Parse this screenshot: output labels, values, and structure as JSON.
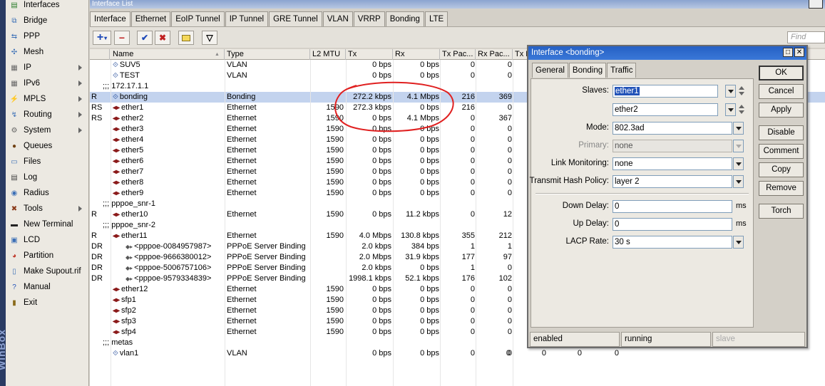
{
  "sidebar_brand": "WinBox",
  "menu": [
    {
      "label": "Interfaces",
      "icon": "interfaces-icon",
      "arrow": false
    },
    {
      "label": "Bridge",
      "icon": "bridge-icon",
      "arrow": false
    },
    {
      "label": "PPP",
      "icon": "ppp-icon",
      "arrow": false
    },
    {
      "label": "Mesh",
      "icon": "mesh-icon",
      "arrow": false
    },
    {
      "label": "IP",
      "icon": "ip-icon",
      "arrow": true
    },
    {
      "label": "IPv6",
      "icon": "ipv6-icon",
      "arrow": true
    },
    {
      "label": "MPLS",
      "icon": "mpls-icon",
      "arrow": true
    },
    {
      "label": "Routing",
      "icon": "routing-icon",
      "arrow": true
    },
    {
      "label": "System",
      "icon": "system-icon",
      "arrow": true
    },
    {
      "label": "Queues",
      "icon": "queues-icon",
      "arrow": false
    },
    {
      "label": "Files",
      "icon": "files-icon",
      "arrow": false
    },
    {
      "label": "Log",
      "icon": "log-icon",
      "arrow": false
    },
    {
      "label": "Radius",
      "icon": "radius-icon",
      "arrow": false
    },
    {
      "label": "Tools",
      "icon": "tools-icon",
      "arrow": true
    },
    {
      "label": "New Terminal",
      "icon": "terminal-icon",
      "arrow": false
    },
    {
      "label": "LCD",
      "icon": "lcd-icon",
      "arrow": false
    },
    {
      "label": "Partition",
      "icon": "partition-icon",
      "arrow": false
    },
    {
      "label": "Make Supout.rif",
      "icon": "supout-icon",
      "arrow": false
    },
    {
      "label": "Manual",
      "icon": "manual-icon",
      "arrow": false
    },
    {
      "label": "Exit",
      "icon": "exit-icon",
      "arrow": false
    }
  ],
  "window": {
    "title": "Interface List",
    "tabs": [
      "Interface",
      "Ethernet",
      "EoIP Tunnel",
      "IP Tunnel",
      "GRE Tunnel",
      "VLAN",
      "VRRP",
      "Bonding",
      "LTE"
    ],
    "find_placeholder": "Find"
  },
  "table": {
    "columns": [
      "Name",
      "Type",
      "L2 MTU",
      "Tx",
      "Rx",
      "Tx Pac...",
      "Rx Pac...",
      "Tx D"
    ],
    "rows": [
      {
        "flag": "",
        "name": "SUV5",
        "icon": "bond",
        "type": "VLAN",
        "mtu": "",
        "tx": "0 bps",
        "rx": "0 bps",
        "txp": "0",
        "rxp": "0",
        "indent": 0
      },
      {
        "flag": "",
        "name": "TEST",
        "icon": "bond",
        "type": "VLAN",
        "mtu": "",
        "tx": "0 bps",
        "rx": "0 bps",
        "txp": "0",
        "rxp": "0",
        "indent": 0
      },
      {
        "group": ";;; 172.17.1.1"
      },
      {
        "flag": "R",
        "name": "bonding",
        "icon": "bond",
        "type": "Bonding",
        "mtu": "",
        "tx": "272.2 kbps",
        "rx": "4.1 Mbps",
        "txp": "216",
        "rxp": "369",
        "indent": 0,
        "selected": true
      },
      {
        "flag": "RS",
        "name": "ether1",
        "icon": "eth",
        "type": "Ethernet",
        "mtu": "1590",
        "tx": "272.3 kbps",
        "rx": "0 bps",
        "txp": "216",
        "rxp": "0",
        "indent": 0
      },
      {
        "flag": "RS",
        "name": "ether2",
        "icon": "eth",
        "type": "Ethernet",
        "mtu": "1590",
        "tx": "0 bps",
        "rx": "4.1 Mbps",
        "txp": "0",
        "rxp": "367",
        "indent": 0
      },
      {
        "flag": "",
        "name": "ether3",
        "icon": "eth",
        "type": "Ethernet",
        "mtu": "1590",
        "tx": "0 bps",
        "rx": "0 bps",
        "txp": "0",
        "rxp": "0",
        "indent": 0
      },
      {
        "flag": "",
        "name": "ether4",
        "icon": "eth",
        "type": "Ethernet",
        "mtu": "1590",
        "tx": "0 bps",
        "rx": "0 bps",
        "txp": "0",
        "rxp": "0",
        "indent": 0
      },
      {
        "flag": "",
        "name": "ether5",
        "icon": "eth",
        "type": "Ethernet",
        "mtu": "1590",
        "tx": "0 bps",
        "rx": "0 bps",
        "txp": "0",
        "rxp": "0",
        "indent": 0
      },
      {
        "flag": "",
        "name": "ether6",
        "icon": "eth",
        "type": "Ethernet",
        "mtu": "1590",
        "tx": "0 bps",
        "rx": "0 bps",
        "txp": "0",
        "rxp": "0",
        "indent": 0
      },
      {
        "flag": "",
        "name": "ether7",
        "icon": "eth",
        "type": "Ethernet",
        "mtu": "1590",
        "tx": "0 bps",
        "rx": "0 bps",
        "txp": "0",
        "rxp": "0",
        "indent": 0
      },
      {
        "flag": "",
        "name": "ether8",
        "icon": "eth",
        "type": "Ethernet",
        "mtu": "1590",
        "tx": "0 bps",
        "rx": "0 bps",
        "txp": "0",
        "rxp": "0",
        "indent": 0
      },
      {
        "flag": "",
        "name": "ether9",
        "icon": "eth",
        "type": "Ethernet",
        "mtu": "1590",
        "tx": "0 bps",
        "rx": "0 bps",
        "txp": "0",
        "rxp": "0",
        "indent": 0
      },
      {
        "group": ";;; pppoe_snr-1"
      },
      {
        "flag": "R",
        "name": "ether10",
        "icon": "eth",
        "type": "Ethernet",
        "mtu": "1590",
        "tx": "0 bps",
        "rx": "11.2 kbps",
        "txp": "0",
        "rxp": "12",
        "indent": 0
      },
      {
        "group": ";;; pppoe_snr-2"
      },
      {
        "flag": "R",
        "name": "ether11",
        "icon": "eth",
        "type": "Ethernet",
        "mtu": "1590",
        "tx": "4.0 Mbps",
        "rx": "130.8 kbps",
        "txp": "355",
        "rxp": "212",
        "indent": 0
      },
      {
        "flag": "DR",
        "name": "<pppoe-0084957987>",
        "icon": "ppp",
        "type": "PPPoE Server Binding",
        "mtu": "",
        "tx": "2.0 kbps",
        "rx": "384 bps",
        "txp": "1",
        "rxp": "1",
        "indent": 1
      },
      {
        "flag": "DR",
        "name": "<pppoe-9666380012>",
        "icon": "ppp",
        "type": "PPPoE Server Binding",
        "mtu": "",
        "tx": "2.0 Mbps",
        "rx": "31.9 kbps",
        "txp": "177",
        "rxp": "97",
        "indent": 1
      },
      {
        "flag": "DR",
        "name": "<pppoe-5006757106>",
        "icon": "ppp",
        "type": "PPPoE Server Binding",
        "mtu": "",
        "tx": "2.0 kbps",
        "rx": "0 bps",
        "txp": "1",
        "rxp": "0",
        "indent": 1
      },
      {
        "flag": "DR",
        "name": "<pppoe-9579334839>",
        "icon": "ppp",
        "type": "PPPoE Server Binding",
        "mtu": "",
        "tx": "1998.1 kbps",
        "rx": "52.1 kbps",
        "txp": "176",
        "rxp": "102",
        "indent": 1
      },
      {
        "flag": "",
        "name": "ether12",
        "icon": "eth",
        "type": "Ethernet",
        "mtu": "1590",
        "tx": "0 bps",
        "rx": "0 bps",
        "txp": "0",
        "rxp": "0",
        "indent": 0
      },
      {
        "flag": "",
        "name": "sfp1",
        "icon": "eth",
        "type": "Ethernet",
        "mtu": "1590",
        "tx": "0 bps",
        "rx": "0 bps",
        "txp": "0",
        "rxp": "0",
        "indent": 0
      },
      {
        "flag": "",
        "name": "sfp2",
        "icon": "eth",
        "type": "Ethernet",
        "mtu": "1590",
        "tx": "0 bps",
        "rx": "0 bps",
        "txp": "0",
        "rxp": "0",
        "indent": 0
      },
      {
        "flag": "",
        "name": "sfp3",
        "icon": "eth",
        "type": "Ethernet",
        "mtu": "1590",
        "tx": "0 bps",
        "rx": "0 bps",
        "txp": "0",
        "rxp": "0",
        "indent": 0
      },
      {
        "flag": "",
        "name": "sfp4",
        "icon": "eth",
        "type": "Ethernet",
        "mtu": "1590",
        "tx": "0 bps",
        "rx": "0 bps",
        "txp": "0",
        "rxp": "0",
        "indent": 0
      },
      {
        "group": ";;; metas"
      },
      {
        "flag": "",
        "name": "vlan1",
        "icon": "bond",
        "type": "VLAN",
        "mtu": "",
        "tx": "0 bps",
        "rx": "0 bps",
        "txp": "0",
        "rxp": "0",
        "indent": 0,
        "extra": [
          "0",
          "0",
          "0",
          "0"
        ]
      }
    ]
  },
  "dialog": {
    "title": "Interface <bonding>",
    "tabs": [
      "General",
      "Bonding",
      "Traffic"
    ],
    "fields": {
      "slaves_label": "Slaves:",
      "slave1": "ether1",
      "slave2": "ether2",
      "mode_label": "Mode:",
      "mode": "802.3ad",
      "primary_label": "Primary:",
      "primary": "none",
      "link_mon_label": "Link Monitoring:",
      "link_mon": "none",
      "hash_label": "Transmit Hash Policy:",
      "hash": "layer 2",
      "down_delay_label": "Down Delay:",
      "down_delay": "0",
      "up_delay_label": "Up Delay:",
      "up_delay": "0",
      "ms": "ms",
      "lacp_label": "LACP Rate:",
      "lacp": "30 s"
    },
    "buttons": [
      "OK",
      "Cancel",
      "Apply",
      "Disable",
      "Comment",
      "Copy",
      "Remove",
      "Torch"
    ],
    "status": [
      "enabled",
      "running",
      "slave"
    ]
  },
  "colors": {
    "selection": "#c3d3ee",
    "dialog_title": "#2560c4",
    "annotation": "#e02020"
  }
}
